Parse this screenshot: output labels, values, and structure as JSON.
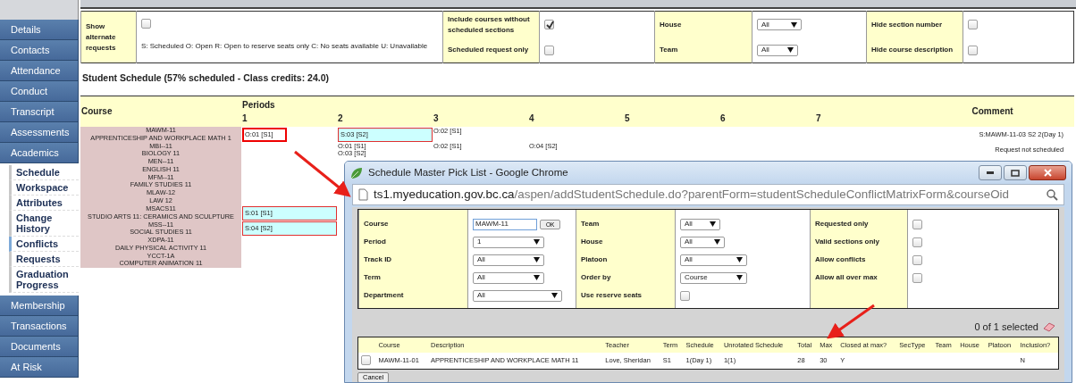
{
  "sidebar": {
    "items": [
      {
        "label": "Details"
      },
      {
        "label": "Contacts"
      },
      {
        "label": "Attendance"
      },
      {
        "label": "Conduct"
      },
      {
        "label": "Transcript"
      },
      {
        "label": "Assessments"
      },
      {
        "label": "Academics",
        "children": [
          {
            "label": "Schedule",
            "selected": false
          },
          {
            "label": "Workspace",
            "selected": false
          },
          {
            "label": "Attributes",
            "selected": false
          },
          {
            "label": "Change History",
            "selected": false
          },
          {
            "label": "Conflicts",
            "selected": true
          },
          {
            "label": "Requests",
            "selected": false
          },
          {
            "label": "Graduation Progress",
            "selected": false
          }
        ]
      },
      {
        "label": "Membership"
      },
      {
        "label": "Transactions"
      },
      {
        "label": "Documents"
      },
      {
        "label": "At Risk"
      }
    ]
  },
  "filters": {
    "alternate": {
      "label": "Show alternate requests",
      "checked": false
    },
    "legend": "S: Scheduled O: Open R: Open to reserve seats only C: No seats available U: Unavailable",
    "groups": [
      {
        "kind": "checkbox",
        "items": [
          {
            "label": "Include courses without scheduled sections",
            "checked": true
          },
          {
            "label": "Scheduled request only",
            "checked": false
          }
        ]
      },
      {
        "kind": "select",
        "items": [
          {
            "label": "House",
            "value": "All"
          },
          {
            "label": "Team",
            "value": "All"
          }
        ]
      },
      {
        "kind": "checkbox",
        "items": [
          {
            "label": "Hide section number",
            "checked": false
          },
          {
            "label": "Hide course description",
            "checked": false
          }
        ]
      }
    ]
  },
  "schedule": {
    "title": "Student Schedule (57% scheduled - Class credits: 24.0)",
    "course_heading": "Course",
    "periods_heading": "Periods",
    "periods": [
      "1",
      "2",
      "3",
      "4",
      "5",
      "6",
      "7"
    ],
    "comment_heading": "Comment",
    "rows": [
      {
        "code": "MAWM-11",
        "name": "APPRENTICESHIP AND WORKPLACE MATH 1",
        "cells": [
          [
            {
              "text": "O:01 [S1]",
              "kind": "open",
              "highlighted": true
            }
          ],
          [
            {
              "text": "S:03 [S2]",
              "kind": "scheduled",
              "highlighted": false
            }
          ],
          [
            {
              "text": "O:02 [S1]",
              "kind": "open",
              "highlighted": false
            }
          ],
          [],
          [],
          [],
          []
        ],
        "comment": "S:MAWM-11-03 S2 2(Day 1)"
      },
      {
        "code": "MBI--11",
        "name": "BIOLOGY 11",
        "cells": [
          [],
          [
            {
              "text": "O:01 [S1]",
              "kind": "open",
              "highlighted": false
            },
            {
              "text": "O:03 [S2]",
              "kind": "open",
              "highlighted": false
            }
          ],
          [
            {
              "text": "O:02 [S1]",
              "kind": "open",
              "highlighted": false
            }
          ],
          [
            {
              "text": "O:04 [S2]",
              "kind": "open",
              "highlighted": false
            }
          ],
          [],
          [],
          []
        ],
        "comment": "Request not scheduled"
      },
      {
        "code": "MEN--11",
        "name": "ENGLISH 11",
        "cells": [
          [],
          [],
          [],
          [],
          [],
          [],
          []
        ]
      },
      {
        "code": "MFM--11",
        "name": "FAMILY STUDIES 11",
        "cells": [
          [],
          [],
          [],
          [],
          [],
          [],
          []
        ]
      },
      {
        "code": "MLAW-12",
        "name": "LAW 12",
        "cells": [
          [],
          [],
          [],
          [],
          [],
          [],
          []
        ]
      },
      {
        "code": "MSACS11",
        "name": "STUDIO ARTS 11: CERAMICS AND SCULPTURE",
        "cells": [
          [
            {
              "text": "S:01 [S1]",
              "kind": "scheduled",
              "highlighted": false
            }
          ],
          [],
          [],
          [],
          [],
          [],
          []
        ]
      },
      {
        "code": "MSS--11",
        "name": "SOCIAL STUDIES 11",
        "cells": [
          [
            {
              "text": "S:04 [S2]",
              "kind": "scheduled",
              "highlighted": false
            }
          ],
          [],
          [],
          [],
          [],
          [],
          []
        ]
      },
      {
        "code": "XDPA-11",
        "name": "DAILY PHYSICAL ACTIVITY 11",
        "cells": [
          [],
          [],
          [],
          [],
          [],
          [],
          []
        ]
      },
      {
        "code": "YCCT-1A",
        "name": "COMPUTER ANIMATION 11",
        "cells": [
          [],
          [],
          [],
          [],
          [],
          [],
          []
        ]
      }
    ]
  },
  "popup": {
    "title": "Schedule Master Pick List - Google Chrome",
    "url_host": "ts1.myeducation.gov.bc.ca",
    "url_path": "/aspen/addStudentSchedule.do?parentForm=studentScheduleConflictMatrixForm&courseOid",
    "form": {
      "columns": [
        [
          {
            "label": "Course",
            "kind": "input",
            "value": "MAWM-11",
            "button": "OK"
          },
          {
            "label": "Period",
            "kind": "select",
            "value": "1"
          },
          {
            "label": "Track ID",
            "kind": "select",
            "value": "All"
          },
          {
            "label": "Term",
            "kind": "select",
            "value": "All"
          },
          {
            "label": "Department",
            "kind": "select",
            "value": "All"
          }
        ],
        [
          {
            "label": "Team",
            "kind": "select",
            "value": "All"
          },
          {
            "label": "House",
            "kind": "select",
            "value": "All"
          },
          {
            "label": "Platoon",
            "kind": "select",
            "value": "All"
          },
          {
            "label": "Order by",
            "kind": "select",
            "value": "Course"
          },
          {
            "label": "Use reserve seats",
            "kind": "checkbox",
            "checked": false
          }
        ],
        [
          {
            "label": "Requested only",
            "kind": "checkbox",
            "checked": false
          },
          {
            "label": "Valid sections only",
            "kind": "checkbox",
            "checked": false
          },
          {
            "label": "Allow conflicts",
            "kind": "checkbox",
            "checked": false
          },
          {
            "label": "Allow all over max",
            "kind": "checkbox",
            "checked": false
          }
        ]
      ]
    },
    "selection_count": "0 of 1 selected",
    "results": {
      "columns": [
        "Course",
        "Description",
        "Teacher",
        "Term",
        "Schedule",
        "Unrotated Schedule",
        "Total",
        "Max",
        "Closed at max?",
        "SecType",
        "Team",
        "House",
        "Platoon",
        "Inclusion?"
      ],
      "rows": [
        {
          "selected": false,
          "cells": [
            "MAWM-11-01",
            "APPRENTICESHIP AND WORKPLACE MATH 11",
            "Love, Sheridan",
            "S1",
            "1(Day 1)",
            "1(1)",
            "28",
            "30",
            "Y",
            null,
            null,
            null,
            null,
            "N"
          ]
        }
      ]
    },
    "cancel_button": "Cancel"
  }
}
